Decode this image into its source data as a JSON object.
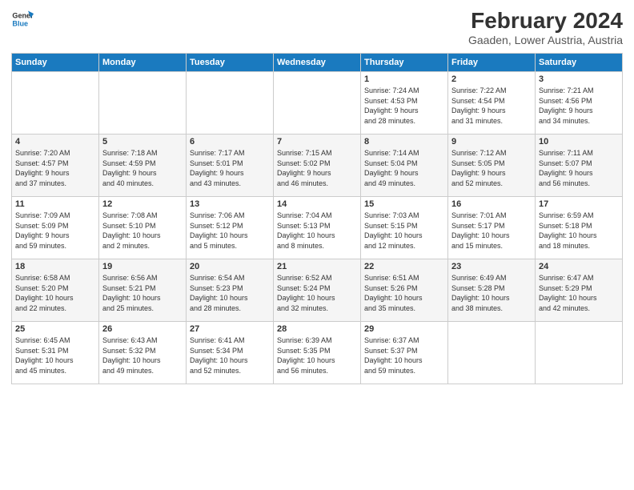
{
  "logo": {
    "line1": "General",
    "line2": "Blue"
  },
  "title": "February 2024",
  "subtitle": "Gaaden, Lower Austria, Austria",
  "headers": [
    "Sunday",
    "Monday",
    "Tuesday",
    "Wednesday",
    "Thursday",
    "Friday",
    "Saturday"
  ],
  "weeks": [
    [
      {
        "day": "",
        "info": ""
      },
      {
        "day": "",
        "info": ""
      },
      {
        "day": "",
        "info": ""
      },
      {
        "day": "",
        "info": ""
      },
      {
        "day": "1",
        "info": "Sunrise: 7:24 AM\nSunset: 4:53 PM\nDaylight: 9 hours\nand 28 minutes."
      },
      {
        "day": "2",
        "info": "Sunrise: 7:22 AM\nSunset: 4:54 PM\nDaylight: 9 hours\nand 31 minutes."
      },
      {
        "day": "3",
        "info": "Sunrise: 7:21 AM\nSunset: 4:56 PM\nDaylight: 9 hours\nand 34 minutes."
      }
    ],
    [
      {
        "day": "4",
        "info": "Sunrise: 7:20 AM\nSunset: 4:57 PM\nDaylight: 9 hours\nand 37 minutes."
      },
      {
        "day": "5",
        "info": "Sunrise: 7:18 AM\nSunset: 4:59 PM\nDaylight: 9 hours\nand 40 minutes."
      },
      {
        "day": "6",
        "info": "Sunrise: 7:17 AM\nSunset: 5:01 PM\nDaylight: 9 hours\nand 43 minutes."
      },
      {
        "day": "7",
        "info": "Sunrise: 7:15 AM\nSunset: 5:02 PM\nDaylight: 9 hours\nand 46 minutes."
      },
      {
        "day": "8",
        "info": "Sunrise: 7:14 AM\nSunset: 5:04 PM\nDaylight: 9 hours\nand 49 minutes."
      },
      {
        "day": "9",
        "info": "Sunrise: 7:12 AM\nSunset: 5:05 PM\nDaylight: 9 hours\nand 52 minutes."
      },
      {
        "day": "10",
        "info": "Sunrise: 7:11 AM\nSunset: 5:07 PM\nDaylight: 9 hours\nand 56 minutes."
      }
    ],
    [
      {
        "day": "11",
        "info": "Sunrise: 7:09 AM\nSunset: 5:09 PM\nDaylight: 9 hours\nand 59 minutes."
      },
      {
        "day": "12",
        "info": "Sunrise: 7:08 AM\nSunset: 5:10 PM\nDaylight: 10 hours\nand 2 minutes."
      },
      {
        "day": "13",
        "info": "Sunrise: 7:06 AM\nSunset: 5:12 PM\nDaylight: 10 hours\nand 5 minutes."
      },
      {
        "day": "14",
        "info": "Sunrise: 7:04 AM\nSunset: 5:13 PM\nDaylight: 10 hours\nand 8 minutes."
      },
      {
        "day": "15",
        "info": "Sunrise: 7:03 AM\nSunset: 5:15 PM\nDaylight: 10 hours\nand 12 minutes."
      },
      {
        "day": "16",
        "info": "Sunrise: 7:01 AM\nSunset: 5:17 PM\nDaylight: 10 hours\nand 15 minutes."
      },
      {
        "day": "17",
        "info": "Sunrise: 6:59 AM\nSunset: 5:18 PM\nDaylight: 10 hours\nand 18 minutes."
      }
    ],
    [
      {
        "day": "18",
        "info": "Sunrise: 6:58 AM\nSunset: 5:20 PM\nDaylight: 10 hours\nand 22 minutes."
      },
      {
        "day": "19",
        "info": "Sunrise: 6:56 AM\nSunset: 5:21 PM\nDaylight: 10 hours\nand 25 minutes."
      },
      {
        "day": "20",
        "info": "Sunrise: 6:54 AM\nSunset: 5:23 PM\nDaylight: 10 hours\nand 28 minutes."
      },
      {
        "day": "21",
        "info": "Sunrise: 6:52 AM\nSunset: 5:24 PM\nDaylight: 10 hours\nand 32 minutes."
      },
      {
        "day": "22",
        "info": "Sunrise: 6:51 AM\nSunset: 5:26 PM\nDaylight: 10 hours\nand 35 minutes."
      },
      {
        "day": "23",
        "info": "Sunrise: 6:49 AM\nSunset: 5:28 PM\nDaylight: 10 hours\nand 38 minutes."
      },
      {
        "day": "24",
        "info": "Sunrise: 6:47 AM\nSunset: 5:29 PM\nDaylight: 10 hours\nand 42 minutes."
      }
    ],
    [
      {
        "day": "25",
        "info": "Sunrise: 6:45 AM\nSunset: 5:31 PM\nDaylight: 10 hours\nand 45 minutes."
      },
      {
        "day": "26",
        "info": "Sunrise: 6:43 AM\nSunset: 5:32 PM\nDaylight: 10 hours\nand 49 minutes."
      },
      {
        "day": "27",
        "info": "Sunrise: 6:41 AM\nSunset: 5:34 PM\nDaylight: 10 hours\nand 52 minutes."
      },
      {
        "day": "28",
        "info": "Sunrise: 6:39 AM\nSunset: 5:35 PM\nDaylight: 10 hours\nand 56 minutes."
      },
      {
        "day": "29",
        "info": "Sunrise: 6:37 AM\nSunset: 5:37 PM\nDaylight: 10 hours\nand 59 minutes."
      },
      {
        "day": "",
        "info": ""
      },
      {
        "day": "",
        "info": ""
      }
    ]
  ]
}
